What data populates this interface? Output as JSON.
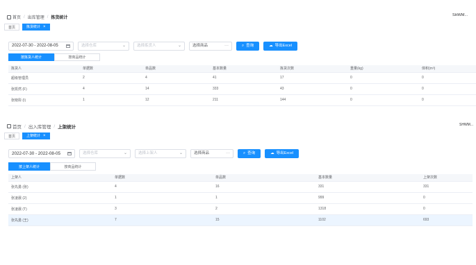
{
  "top": {
    "breadcrumb": {
      "home": "首页",
      "section": "出库管理",
      "current": "拣货统计"
    },
    "user": "SHWM...",
    "tabs": {
      "home": "首页",
      "active": "拣货统计"
    },
    "filters": {
      "date_range": "2022-07-30 - 2022-08-05",
      "warehouse_placeholder": "选择仓库",
      "picker_placeholder": "选择拣货人",
      "product_placeholder": "选择商品",
      "query_label": "查询",
      "export_label": "导出Excel"
    },
    "subtabs": [
      "按拣货人统计",
      "按商品统计"
    ],
    "columns": [
      "拣货人",
      "单据数",
      "单品数",
      "基本数量",
      "拣货次数",
      "重量(kg)",
      "体积(m³)"
    ],
    "rows": [
      [
        "超级管理员",
        "2",
        "4",
        "41",
        "17",
        "0",
        "0"
      ],
      [
        "张凯然 (F)",
        "4",
        "14",
        "333",
        "43",
        "0",
        "0"
      ],
      [
        "张晓彤 (I)",
        "1",
        "12",
        "211",
        "144",
        "0",
        "0"
      ]
    ]
  },
  "bottom": {
    "breadcrumb": {
      "home": "首页",
      "section": "出入库管理",
      "current": "上架统计"
    },
    "user": "SHWM...",
    "tabs": {
      "home": "首页",
      "active": "上架统计"
    },
    "filters": {
      "date_range": "2022-07-30 - 2022-08-05",
      "warehouse_placeholder": "选择仓库",
      "putaway_placeholder": "选择上架人",
      "product_placeholder": "选择商品",
      "query_label": "查询",
      "export_label": "导出Excel"
    },
    "subtabs": [
      "按上架人统计",
      "按商品统计"
    ],
    "columns": [
      "上架人",
      "单据数",
      "单品数",
      "基本数量",
      "上架次数"
    ],
    "rows": [
      [
        "张先勇 (张)",
        "4",
        "16",
        "331",
        "331"
      ],
      [
        "张凌晨 (2)",
        "1",
        "1",
        "999",
        "0"
      ],
      [
        "张凌晨 (T)",
        "3",
        "2",
        "1318",
        "0"
      ],
      [
        "张先勇 (王)",
        "7",
        "15",
        "1102",
        "693"
      ]
    ],
    "highlighted_row": 3
  },
  "colors": {
    "primary": "#1890ff",
    "header_bg": "#f5f7fa",
    "highlight_bg": "#ecf5ff"
  },
  "icons": [
    "home-icon",
    "calendar-icon",
    "chevron-down-icon",
    "search-icon",
    "cloud-download-icon",
    "close-icon"
  ]
}
